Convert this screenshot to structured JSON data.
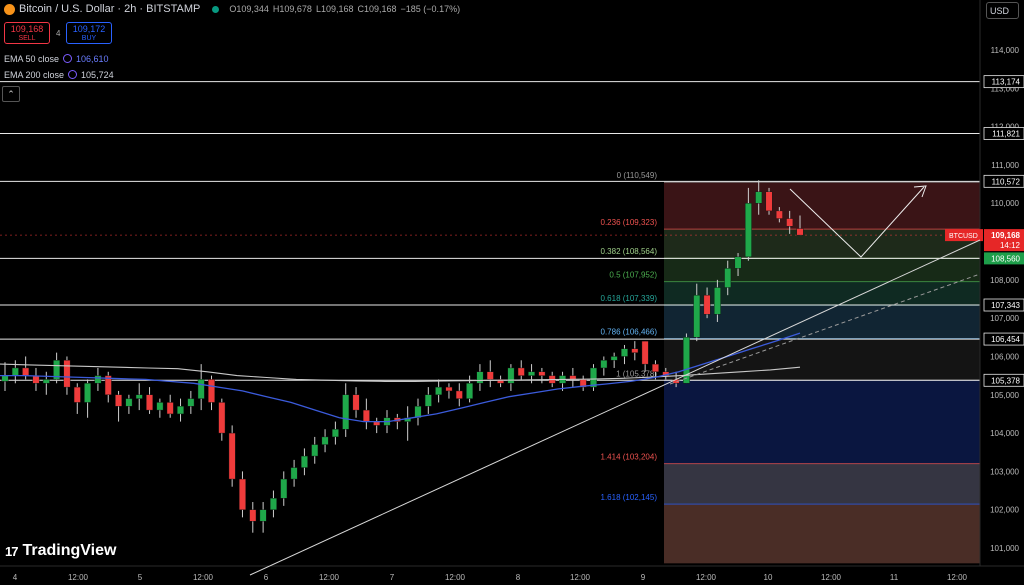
{
  "header": {
    "symbol": "Bitcoin / U.S. Dollar · 2h · BITSTAMP",
    "ohlc_open": "O109,344",
    "ohlc_high": "H109,678",
    "ohlc_low": "L109,168",
    "ohlc_close": "C109,168",
    "ohlc_change": "−185 (−0.17%)"
  },
  "trade": {
    "sell_price": "109,168",
    "sell_label": "SELL",
    "spread": "4",
    "buy_price": "109,172",
    "buy_label": "BUY"
  },
  "indicators": {
    "ema50_label": "EMA 50 close",
    "ema50_value": "106,610",
    "ema200_label": "EMA 200 close",
    "ema200_value": "105,724"
  },
  "currency": "USD",
  "brand": "TradingView",
  "colors": {
    "up": "#26a69a",
    "up_fill": "#1fa84a",
    "down": "#ef3b3b",
    "ema50": "#3b5bdb",
    "ema200": "#c8c8c8",
    "price_tag": "#e62727",
    "support_tag": "#1e9e4a"
  },
  "chart_data": {
    "type": "candlestick",
    "title": "Bitcoin / U.S. Dollar · 2h · BITSTAMP",
    "ylim": [
      100600,
      115000
    ],
    "y_ticks": [
      "114,000",
      "113,000",
      "112,000",
      "111,000",
      "110,000",
      "109,000",
      "108,000",
      "107,000",
      "106,000",
      "105,000",
      "104,000",
      "103,000",
      "102,000",
      "101,000"
    ],
    "y_tick_values": [
      114000,
      113000,
      112000,
      111000,
      110000,
      109000,
      108000,
      107000,
      106000,
      105000,
      104000,
      103000,
      102000,
      101000
    ],
    "x_ticks": [
      "4",
      "12:00",
      "5",
      "12:00",
      "6",
      "12:00",
      "7",
      "12:00",
      "8",
      "12:00",
      "9",
      "12:00",
      "10",
      "12:00",
      "11",
      "12:00"
    ],
    "candles": [
      [
        105.35,
        105.85,
        105.1,
        105.5
      ],
      [
        105.5,
        105.9,
        105.3,
        105.7
      ],
      [
        105.7,
        106.0,
        105.4,
        105.5
      ],
      [
        105.5,
        105.7,
        105.1,
        105.3
      ],
      [
        105.3,
        105.6,
        105.0,
        105.4
      ],
      [
        105.4,
        106.1,
        105.3,
        105.9
      ],
      [
        105.9,
        106.0,
        105.0,
        105.2
      ],
      [
        105.2,
        105.3,
        104.5,
        104.8
      ],
      [
        104.8,
        105.4,
        104.4,
        105.3
      ],
      [
        105.3,
        105.7,
        105.1,
        105.5
      ],
      [
        105.5,
        105.6,
        104.8,
        105.0
      ],
      [
        105.0,
        105.1,
        104.3,
        104.7
      ],
      [
        104.7,
        105.0,
        104.5,
        104.9
      ],
      [
        104.9,
        105.3,
        104.6,
        105.0
      ],
      [
        105.0,
        105.2,
        104.5,
        104.6
      ],
      [
        104.6,
        104.9,
        104.4,
        104.8
      ],
      [
        104.8,
        105.0,
        104.4,
        104.5
      ],
      [
        104.5,
        104.9,
        104.3,
        104.7
      ],
      [
        104.7,
        105.1,
        104.5,
        104.9
      ],
      [
        104.9,
        105.8,
        104.6,
        105.4
      ],
      [
        105.4,
        105.5,
        104.6,
        104.8
      ],
      [
        104.8,
        104.9,
        103.8,
        104.0
      ],
      [
        104.0,
        104.2,
        102.6,
        102.8
      ],
      [
        102.8,
        103.0,
        101.8,
        102.0
      ],
      [
        102.0,
        102.2,
        101.4,
        101.7
      ],
      [
        101.7,
        102.2,
        101.4,
        102.0
      ],
      [
        102.0,
        102.5,
        101.8,
        102.3
      ],
      [
        102.3,
        103.0,
        102.1,
        102.8
      ],
      [
        102.8,
        103.3,
        102.6,
        103.1
      ],
      [
        103.1,
        103.6,
        102.9,
        103.4
      ],
      [
        103.4,
        103.9,
        103.2,
        103.7
      ],
      [
        103.7,
        104.1,
        103.5,
        103.9
      ],
      [
        103.9,
        104.3,
        103.7,
        104.1
      ],
      [
        104.1,
        105.3,
        103.9,
        105.0
      ],
      [
        105.0,
        105.2,
        104.4,
        104.6
      ],
      [
        104.6,
        104.9,
        104.1,
        104.3
      ],
      [
        104.3,
        104.4,
        104.0,
        104.2
      ],
      [
        104.2,
        104.6,
        104.0,
        104.4
      ],
      [
        104.4,
        104.5,
        104.1,
        104.3
      ],
      [
        104.3,
        104.7,
        103.8,
        104.4
      ],
      [
        104.4,
        104.9,
        104.2,
        104.7
      ],
      [
        104.7,
        105.2,
        104.5,
        105.0
      ],
      [
        105.0,
        105.4,
        104.8,
        105.2
      ],
      [
        105.2,
        105.3,
        104.9,
        105.1
      ],
      [
        105.1,
        105.3,
        104.7,
        104.9
      ],
      [
        104.9,
        105.5,
        104.8,
        105.3
      ],
      [
        105.3,
        105.8,
        105.1,
        105.6
      ],
      [
        105.6,
        105.9,
        105.2,
        105.4
      ],
      [
        105.4,
        105.5,
        105.2,
        105.3
      ],
      [
        105.3,
        105.8,
        105.1,
        105.7
      ],
      [
        105.7,
        105.9,
        105.4,
        105.5
      ],
      [
        105.5,
        105.8,
        105.3,
        105.6
      ],
      [
        105.6,
        105.7,
        105.3,
        105.5
      ],
      [
        105.5,
        105.6,
        105.2,
        105.3
      ],
      [
        105.3,
        105.6,
        105.1,
        105.5
      ],
      [
        105.5,
        105.7,
        105.2,
        105.4
      ],
      [
        105.4,
        105.5,
        105.1,
        105.2
      ],
      [
        105.2,
        105.8,
        105.1,
        105.7
      ],
      [
        105.7,
        106.0,
        105.5,
        105.9
      ],
      [
        105.9,
        106.1,
        105.7,
        106.0
      ],
      [
        106.0,
        106.3,
        105.8,
        106.2
      ],
      [
        106.2,
        106.4,
        105.9,
        106.1
      ],
      [
        106.4,
        106.4,
        105.6,
        105.8
      ],
      [
        105.8,
        105.9,
        105.4,
        105.6
      ],
      [
        105.6,
        105.7,
        105.4,
        105.5
      ],
      [
        105.4,
        105.6,
        105.2,
        105.3
      ],
      [
        105.3,
        106.6,
        105.3,
        106.5
      ],
      [
        106.5,
        107.9,
        106.4,
        107.6
      ],
      [
        107.6,
        107.8,
        107.0,
        107.1
      ],
      [
        107.1,
        108.0,
        106.9,
        107.8
      ],
      [
        107.8,
        108.5,
        107.6,
        108.3
      ],
      [
        108.3,
        108.7,
        108.1,
        108.6
      ],
      [
        108.6,
        110.4,
        108.5,
        110.0
      ],
      [
        110.0,
        110.6,
        109.7,
        110.3
      ],
      [
        110.3,
        110.4,
        109.7,
        109.8
      ],
      [
        109.8,
        109.9,
        109.5,
        109.6
      ],
      [
        109.6,
        109.8,
        109.2,
        109.4
      ],
      [
        109.34,
        109.68,
        109.168,
        109.168
      ]
    ],
    "ema50": [
      105.5,
      105.5,
      105.48,
      105.46,
      105.44,
      105.42,
      105.4,
      105.35,
      105.3,
      105.2,
      105.1,
      104.95,
      104.8,
      104.6,
      104.4,
      104.3,
      104.3,
      104.4,
      104.5,
      104.65,
      104.8,
      104.95,
      105.05,
      105.15,
      105.22,
      105.28,
      105.35,
      105.45,
      105.6,
      105.8,
      106.0,
      106.2,
      106.4,
      106.61
    ],
    "ema200": [
      105.8,
      105.78,
      105.76,
      105.74,
      105.72,
      105.7,
      105.68,
      105.6,
      105.5,
      105.45,
      105.4,
      105.38,
      105.36,
      105.35,
      105.35,
      105.36,
      105.37,
      105.38,
      105.39,
      105.4,
      105.41,
      105.43,
      105.46,
      105.5,
      105.55,
      105.6,
      105.65,
      105.72
    ],
    "price_levels": [
      {
        "label": "113,174",
        "value": 113174
      },
      {
        "label": "111,821",
        "value": 111821
      },
      {
        "label": "110,572",
        "value": 110572
      },
      {
        "label": "108,560",
        "value": 108560
      },
      {
        "label": "107,343",
        "value": 107343
      },
      {
        "label": "106,454",
        "value": 106454
      },
      {
        "label": "105,378",
        "value": 105378
      }
    ],
    "fib_levels": [
      {
        "label": "0 (110,549)",
        "value": 110549,
        "color": "#999999"
      },
      {
        "label": "0.236 (109,323)",
        "value": 109323,
        "color": "#ef5350"
      },
      {
        "label": "0.382 (108,564)",
        "value": 108564,
        "color": "#9fd08a"
      },
      {
        "label": "0.5 (107,952)",
        "value": 107952,
        "color": "#4caf50"
      },
      {
        "label": "0.618 (107,339)",
        "value": 107339,
        "color": "#26a69a"
      },
      {
        "label": "0.786 (106,466)",
        "value": 106466,
        "color": "#64b5f6"
      },
      {
        "label": "1 (105,378)",
        "value": 105378,
        "color": "#999999"
      },
      {
        "label": "1.414 (103,204)",
        "value": 103204,
        "color": "#ef5350"
      },
      {
        "label": "1.618 (102,145)",
        "value": 102145,
        "color": "#2962ff"
      }
    ],
    "current_price": {
      "symbol": "BTCUSD",
      "value": "109,168",
      "countdown": "14:12",
      "price": 109168
    },
    "support_tag": {
      "value": "108,560",
      "price": 108560
    }
  }
}
